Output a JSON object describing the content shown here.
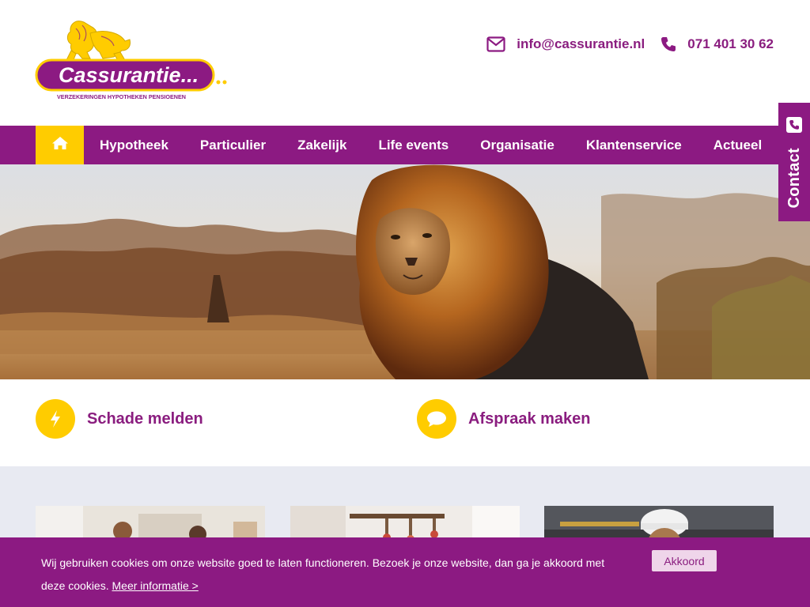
{
  "brand": {
    "name": "Cassurantie...",
    "tagline": "VERZEKERINGEN HYPOTHEKEN PENSIOENEN"
  },
  "contact": {
    "email": "info@cassurantie.nl",
    "phone": "071 401 30 62",
    "side_label": "Contact"
  },
  "nav": {
    "items": [
      {
        "label": "Hypotheek"
      },
      {
        "label": "Particulier"
      },
      {
        "label": "Zakelijk"
      },
      {
        "label": "Life events"
      },
      {
        "label": "Organisatie"
      },
      {
        "label": "Klantenservice"
      },
      {
        "label": "Actueel"
      }
    ]
  },
  "quick_actions": [
    {
      "label": "Schade melden",
      "icon": "lightning-icon"
    },
    {
      "label": "Afspraak maken",
      "icon": "chat-bubble-icon"
    }
  ],
  "cookie": {
    "message": "Wij gebruiken cookies om onze website goed te laten functioneren. Bezoek je onze website, dan ga je akkoord met deze cookies.",
    "more_link": "Meer informatie >",
    "accept_label": "Akkoord"
  },
  "colors": {
    "primary": "#8c1a82",
    "accent": "#ffcc00",
    "section_bg": "#e8eaf2"
  }
}
